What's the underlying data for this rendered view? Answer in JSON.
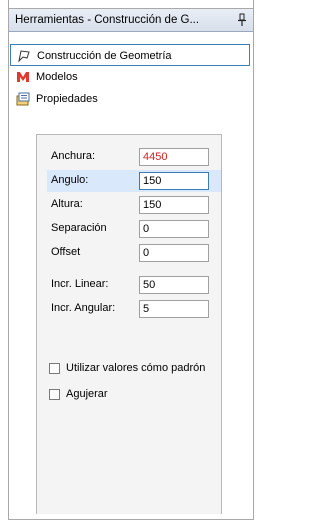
{
  "titlebar": {
    "title": "Herramientas - Construcción de G...",
    "pin_icon": "pin-icon"
  },
  "sections": [
    {
      "label": "Construcción de Geometría",
      "icon": "geometry-icon",
      "active": true
    },
    {
      "label": "Modelos",
      "icon": "models-icon",
      "active": false
    },
    {
      "label": "Propiedades",
      "icon": "properties-icon",
      "active": false
    }
  ],
  "form": {
    "anchura": {
      "label": "Anchura:",
      "value": "4450",
      "color": "#d42020"
    },
    "angulo": {
      "label": "Angulo:",
      "value": "150"
    },
    "altura": {
      "label": "Altura:",
      "value": "150"
    },
    "separacion": {
      "label": "Separación",
      "value": "0"
    },
    "offset": {
      "label": "Offset",
      "value": "0"
    },
    "incr_linear": {
      "label": "Incr. Linear:",
      "value": "50"
    },
    "incr_angular": {
      "label": "Incr. Angular:",
      "value": "5"
    }
  },
  "checkboxes": {
    "utilizar": {
      "label": "Utilizar valores cómo padrón",
      "checked": false
    },
    "agujerar": {
      "label": "Agujerar",
      "checked": false
    }
  }
}
